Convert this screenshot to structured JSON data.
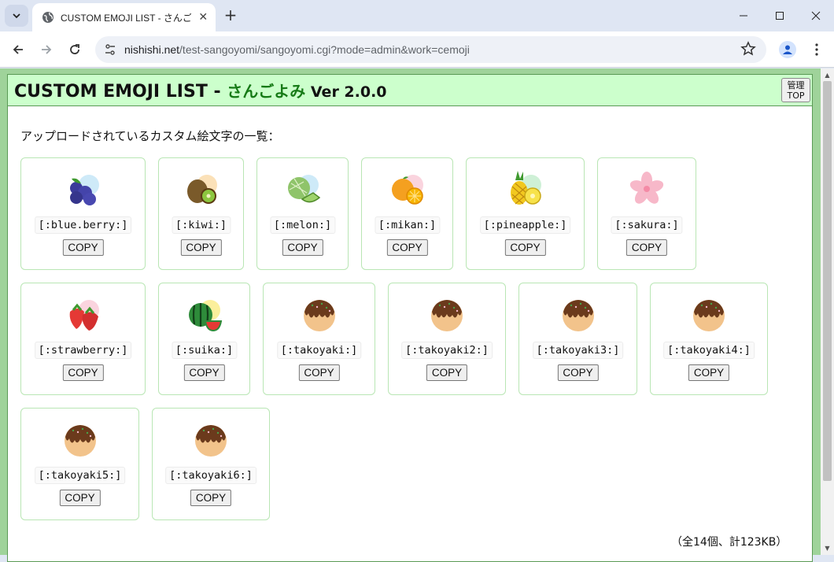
{
  "browser": {
    "tab_title": "CUSTOM EMOJI LIST - さんごよみ",
    "url_host": "nishishi.net",
    "url_path": "/test-sangoyomi/sangoyomi.cgi?mode=admin&work=cemoji"
  },
  "header": {
    "title": "CUSTOM EMOJI LIST - ",
    "app_name": "さんごよみ",
    "version": " Ver 2.0.0",
    "admin_line1": "管理",
    "admin_line2": "TOP"
  },
  "intro": "アップロードされているカスタム絵文字の一覧：",
  "copy_label": "COPY",
  "emojis": [
    {
      "code": "[:blue.berry:]",
      "icon": "blueberry-icon"
    },
    {
      "code": "[:kiwi:]",
      "icon": "kiwi-icon"
    },
    {
      "code": "[:melon:]",
      "icon": "melon-icon"
    },
    {
      "code": "[:mikan:]",
      "icon": "mikan-icon"
    },
    {
      "code": "[:pineapple:]",
      "icon": "pineapple-icon"
    },
    {
      "code": "[:sakura:]",
      "icon": "sakura-icon"
    },
    {
      "code": "[:strawberry:]",
      "icon": "strawberry-icon"
    },
    {
      "code": "[:suika:]",
      "icon": "suika-icon"
    },
    {
      "code": "[:takoyaki:]",
      "icon": "takoyaki-icon"
    },
    {
      "code": "[:takoyaki2:]",
      "icon": "takoyaki-icon"
    },
    {
      "code": "[:takoyaki3:]",
      "icon": "takoyaki-icon"
    },
    {
      "code": "[:takoyaki4:]",
      "icon": "takoyaki-icon"
    },
    {
      "code": "[:takoyaki5:]",
      "icon": "takoyaki-icon"
    },
    {
      "code": "[:takoyaki6:]",
      "icon": "takoyaki-icon"
    }
  ],
  "footer": "（全14個、計123KB）",
  "colors": {
    "header_bg": "#ccffcc",
    "app_name": "#167a16",
    "frame_border": "#5a9a55"
  }
}
